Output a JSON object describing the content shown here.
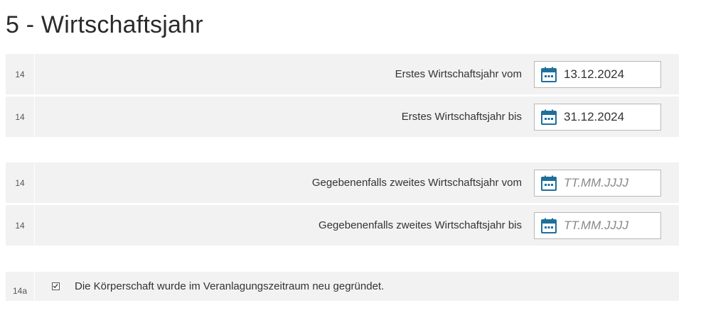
{
  "page": {
    "title": "5 - Wirtschaftsjahr"
  },
  "fields": [
    {
      "number": "14",
      "label": "Erstes Wirtschaftsjahr vom",
      "value": "13.12.2024",
      "placeholder": ""
    },
    {
      "number": "14",
      "label": "Erstes Wirtschaftsjahr bis",
      "value": "31.12.2024",
      "placeholder": ""
    },
    {
      "number": "14",
      "label": "Gegebenenfalls zweites Wirtschaftsjahr vom",
      "value": "",
      "placeholder": "TT.MM.JJJJ"
    },
    {
      "number": "14",
      "label": "Gegebenenfalls zweites Wirtschaftsjahr bis",
      "value": "",
      "placeholder": "TT.MM.JJJJ"
    }
  ],
  "checkbox_row": {
    "number": "14a",
    "label": "Die Körperschaft wurde im Veranlagungszeitraum neu gegründet.",
    "checked": true
  },
  "icons": {
    "calendar": "calendar-icon",
    "checkmark": "checkmark-icon"
  },
  "colors": {
    "calendar_icon": "#1f6f9a",
    "row_background": "#f2f2f2"
  }
}
